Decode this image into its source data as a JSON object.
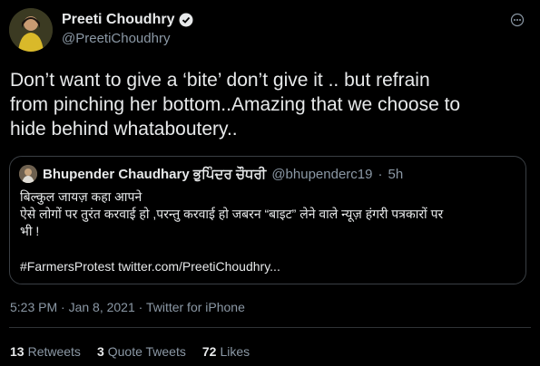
{
  "author": {
    "name": "Preeti Choudhry",
    "handle": "@PreetiChoudhry",
    "verified": true
  },
  "tweet": {
    "lines": [
      "Don’t want to give a ‘bite’  don’t give it .. but refrain",
      "from pinching her bottom..Amazing that we choose to",
      "hide behind whataboutery.."
    ]
  },
  "quoted": {
    "name": "Bhupender Chaudhary ਭੁਪਿੰਦਰ ਚੌਧਰੀ",
    "handle": "@bhupenderc19",
    "separator": "·",
    "time": "5h",
    "lines": [
      "बिल्कुल जायज़ कहा आपने",
      "ऐसे लोगों पर तुरंत करवाई हो ,परन्तु करवाई हो जबरन “बाइट” लेने वाले न्यूज़ हंगरी पत्रकारों पर",
      "भी !"
    ],
    "hashtag_link": "#FarmersProtest twitter.com/PreetiChoudhry..."
  },
  "meta": "5:23 PM · Jan 8, 2021 · Twitter for iPhone",
  "stats": {
    "retweets_count": "13",
    "retweets_label": "Retweets",
    "quotes_count": "3",
    "quotes_label": "Quote Tweets",
    "likes_count": "72",
    "likes_label": "Likes"
  },
  "colors": {
    "background": "#000000",
    "text": "#e7e9ea",
    "secondary": "#8b98a5",
    "verified": "#1d9bf0",
    "border": "#3a3f44"
  }
}
